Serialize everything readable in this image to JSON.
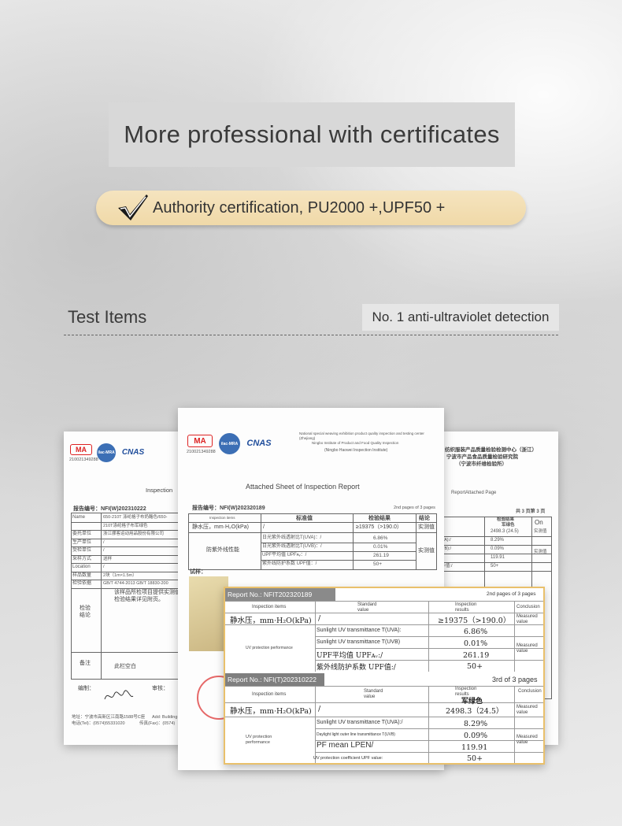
{
  "headline": "More professional with certificates",
  "pill": {
    "text": "Authority certification, PU2000 +,UPF50 +"
  },
  "section": {
    "title": "Test Items",
    "detection": "No. 1 anti-ultraviolet detection"
  },
  "left_doc": {
    "ma_logo": "MA",
    "ma_code": "210021349288",
    "ilac_logo": "ilac-MRA",
    "cnas_logo": "CNAS",
    "title": "Inspection",
    "report_no": "报告编号：NFI(W)202310222",
    "rows": [
      {
        "label": "Name",
        "value": "650-210T 涤纶格子布奶酪色/650-"
      },
      {
        "label": "",
        "value": "210T涤纶格子布军绿色"
      },
      {
        "label": "委托单位",
        "value": "浙江挪客运动用品股份有限公司"
      },
      {
        "label": "生产单位",
        "value": "/"
      },
      {
        "label": "受检单位",
        "value": "/"
      },
      {
        "label": "采样方式",
        "value": "送样"
      },
      {
        "label": "Location",
        "value": "/"
      },
      {
        "label": "样品数量",
        "value": "2块（1m×1.5m）"
      },
      {
        "label": "检验依据",
        "value": "GB/T 4744-2013 GB/T 18830-200"
      }
    ],
    "conclusion_label": "检验结论",
    "conclusion_text": "该样品所检项目提供实测值，检验结果详见附页。",
    "remarks_label": "备注",
    "remarks_value": "此栏空白",
    "compiler": "编制：",
    "reviewer": "审核：",
    "address": "地址：宁波市高新区江南路1588号C座",
    "address_en": "Add: Building",
    "tel": "电话(Tel)：(0574)55331020",
    "fax": "传真(Fax)：(0574)"
  },
  "right_doc": {
    "heading1": "纺织服装产品质量检验检测中心（浙江）",
    "heading2": "宁波市产品食品质量检验研究院",
    "heading3": "（宁波市纤维检验所）",
    "subtitle": "ReportAttached Page",
    "page": "共 3 页第 3 页",
    "col_result": "检验结果",
    "col_result2": "军绿色",
    "col_on": "On",
    "values": [
      "2498.3 (24.5)",
      "8.29%",
      "0.09%",
      "119.91",
      "50+"
    ],
    "left_bits": [
      "(UVA):/",
      "(UVB):/",
      "ᵥ:/",
      "UPF值:/"
    ],
    "measured": [
      "实测值",
      "实测值"
    ]
  },
  "mid_doc": {
    "ma_logo": "MA",
    "ma_code": "210021349288",
    "ilac_logo": "ilac-MRA",
    "cnas_logo": "CNAS",
    "center_line1": "National special weaving exhibition product quality inspection and testing center (Zhejiang)",
    "center_line2": "Ningbo Institute of Product and Food Quality Inspection",
    "center_line3": "(Ningbo Haowei Inspection Institute)",
    "title": "Attached Sheet of Inspection Report",
    "report_no": "报告编号：NFI(W)202320189",
    "pages": "2nd pages of 3 pages",
    "col_item_en": "Inspection items",
    "col_standard": "标准值",
    "col_result": "检验结果",
    "col_conclusion": "结论",
    "row1_item": "静水压，mm·H₂O(kPa)",
    "row1_std": "/",
    "row1_result": "≥19375（>190.0）",
    "row1_conc": "实测值",
    "group_label": "防紫外线性能",
    "sub_items": [
      "日光紫外线透射比T(UVA)：/",
      "日光紫外线透射比T(UVB)：/",
      "UPF平均值 UPFᴀᵥ：/",
      "紫外线防护系数 UPF值：/"
    ],
    "sub_values": [
      "6.86%",
      "0.01%",
      "261.19",
      "50+"
    ],
    "group_conc": "实测值",
    "sample_label": "试样："
  },
  "zoom": {
    "bar1": "Report No.: NFIT202320189",
    "pages1": "2nd pages of 3 pages",
    "h_items": "Inspection items",
    "h_standard": "Standard value",
    "h_results": "Inspection results",
    "h_conclusion": "Conclusion",
    "r1_item": "静水压，mm·H₂O(kPa)",
    "r1_std": "/",
    "r1_result": "≥19375（>190.0）",
    "r1_conc": "Measured value",
    "group1": "UV protection performance",
    "s1": "Sunlight UV transmittance T(UVA):",
    "s2": "Sunlight UV transmittance T(UVB)",
    "s3": "UPF平均值 UPFᴀᵥ:/",
    "s4": "紫外线防护系数 UPF值:/",
    "v1": "6.86%",
    "v2": "0.01%",
    "v3": "261.19",
    "v4": "50+",
    "g1_conc": "Measured value",
    "bar2": "Report No.: NFI(T)202310222",
    "pages2": "3rd of 3 pages",
    "h2_items": "Inspection items",
    "h2_standard": "Standard value",
    "h2_results": "Inspection results",
    "h2_result_value": "军绿色",
    "h2_conclusion": "Conclusion",
    "r2_item": "静水压，mm·H₂O(kPa)",
    "r2_std": "/",
    "r2_result": "2498.3（24.5）",
    "r2_conc": "Measured value",
    "group2": "UV protection performance",
    "t1": "Sunlight UV transmittance T(UVA):/",
    "t2": "Daylight light outer line transmittance T(UVB)",
    "t3": "PF mean LPEN/",
    "t4": "UV protection coefficient UPF value:",
    "w1": "8.29%",
    "w2": "0.09%",
    "w3": "119.91",
    "w4": "50+",
    "g2_conc": "Measured value"
  }
}
